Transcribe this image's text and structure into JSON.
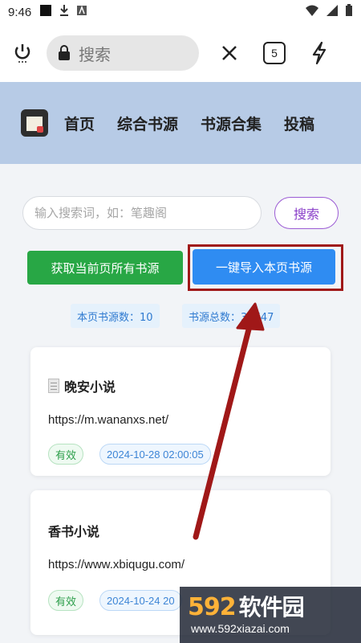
{
  "status_bar": {
    "time": "9:46"
  },
  "browser": {
    "search_placeholder": "搜索",
    "tab_count": "5"
  },
  "site_nav": {
    "items": [
      "首页",
      "综合书源",
      "书源合集",
      "投稿"
    ]
  },
  "search": {
    "placeholder": "输入搜索词，如：笔趣阁",
    "button_label": "搜索"
  },
  "actions": {
    "get_all_label": "获取当前页所有书源",
    "import_label": "一键导入本页书源"
  },
  "stats": {
    "page_count_label": "本页书源数：10",
    "total_count_label": "书源总数：32747"
  },
  "cards": [
    {
      "title": "晚安小说",
      "url": "https://m.wananxs.net/",
      "status": "有效",
      "date": "2024-10-28 02:00:05"
    },
    {
      "title": "香书小说",
      "url": "https://www.xbiqugu.com/",
      "status": "有效",
      "date": "2024-10-24 20"
    }
  ],
  "watermark": {
    "logo_num": "592",
    "logo_cn": "软件园",
    "url": "www.592xiazai.com"
  },
  "colors": {
    "nav_bg": "#b7cbe6",
    "green": "#28a745",
    "blue": "#2f8cf2",
    "highlight": "#a01818",
    "arrow": "#a01818"
  }
}
